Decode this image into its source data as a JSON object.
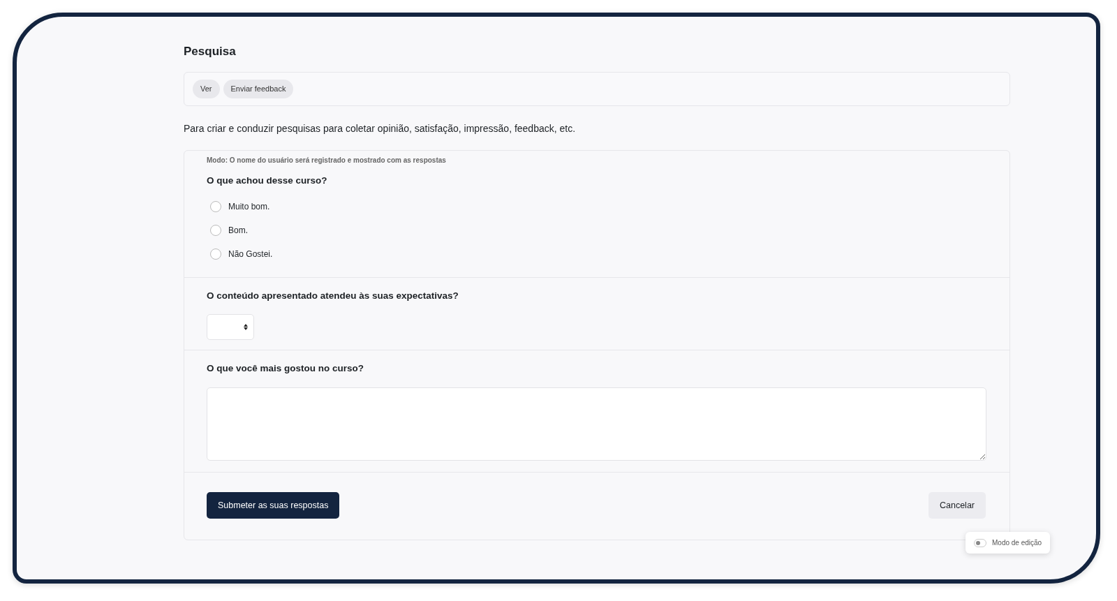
{
  "page": {
    "title": "Pesquisa"
  },
  "tabs": [
    {
      "label": "Ver",
      "selected": false
    },
    {
      "label": "Enviar feedback",
      "selected": false
    }
  ],
  "description": "Para criar e conduzir pesquisas para coletar opinião, satisfação, impressão, feedback, etc.",
  "form": {
    "mode_note": "Modo: O nome do usuário será registrado e mostrado com as respostas",
    "questions": [
      {
        "kind": "radio",
        "label": "O que achou desse curso?",
        "options": [
          {
            "label": "Muito bom.",
            "selected": false
          },
          {
            "label": "Bom.",
            "selected": false
          },
          {
            "label": "Não Gostei.",
            "selected": false
          }
        ]
      },
      {
        "kind": "select",
        "label": "O conteúdo apresentado atendeu às suas expectativas?"
      },
      {
        "kind": "textarea",
        "label": "O que você mais gostou no curso?"
      }
    ],
    "submit_button": "Submeter as suas respostas",
    "cancel_button": "Cancelar"
  },
  "edit_mode": {
    "label": "Modo de edição",
    "on": false
  }
}
